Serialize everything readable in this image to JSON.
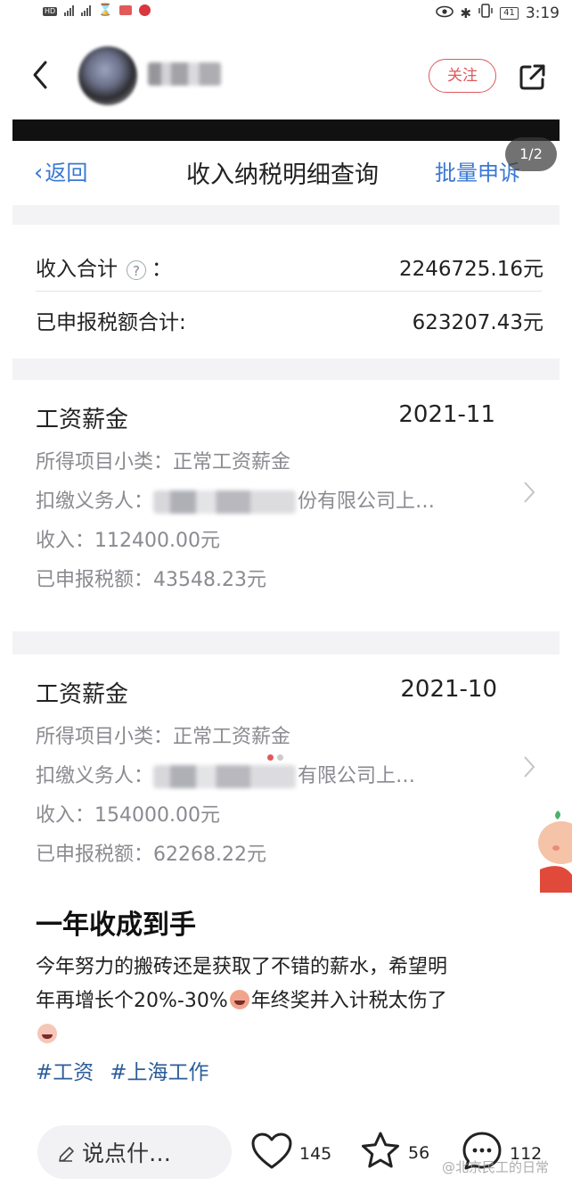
{
  "status_bar": {
    "time": "3:19",
    "battery": "41",
    "left_icons": [
      "hd-icon",
      "signal-icon",
      "signal-icon",
      "hourglass-icon",
      "wallet-icon",
      "bank-icon"
    ],
    "right_icons": [
      "eye-icon",
      "bluetooth-icon",
      "vibrate-icon"
    ]
  },
  "header": {
    "follow_label": "关注"
  },
  "screenshot": {
    "nav": {
      "back_label": "返回",
      "title": "收入纳税明细查询",
      "batch_label": "批量申诉"
    },
    "page_indicator": "1/2",
    "summary": {
      "income_label": "收入合计",
      "income_colon": "：",
      "help_glyph": "?",
      "income_value": "2246725.16元",
      "tax_label": "已申报税额合计:",
      "tax_value": "623207.43元"
    },
    "records": [
      {
        "category": "工资薪金",
        "date": "2021-11",
        "subtype": "所得项目小类：正常工资薪金",
        "withholder_prefix": "扣缴义务人：",
        "withholder_visible": "份有限公司上…",
        "income": "收入：112400.00元",
        "tax": "已申报税额：43548.23元"
      },
      {
        "category": "工资薪金",
        "date": "2021-10",
        "subtype": "所得项目小类：正常工资薪金",
        "withholder_prefix": "扣缴义务人：",
        "withholder_visible": "有限公司上…",
        "income": "收入：154000.00元",
        "tax": "已申报税额：62268.22元"
      }
    ],
    "carousel": {
      "total": 2,
      "active": 1
    }
  },
  "post": {
    "title": "一年收成到手",
    "body_line1": "今年努力的搬砖还是获取了不错的薪水，希望明",
    "body_line2a": "年再增长个20%-30%",
    "body_line2b": "年终奖并入计税太伤了",
    "tags": [
      "#工资",
      "#上海工作"
    ]
  },
  "actions": {
    "comment_placeholder": "说点什…",
    "likes": "145",
    "favorites": "56",
    "comments": "112"
  },
  "watermark": "@北京民工的日常"
}
